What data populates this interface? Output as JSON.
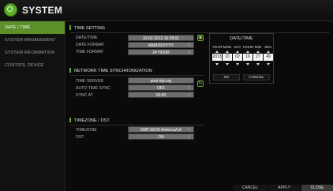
{
  "header": {
    "title": "SYSTEM"
  },
  "sidebar": {
    "items": [
      {
        "label": "DATE / TIME",
        "active": true
      },
      {
        "label": "SYSTEM MANAGEMENT",
        "active": false
      },
      {
        "label": "SYSTEM INFORMATION",
        "active": false
      },
      {
        "label": "CONTROL DEVICE",
        "active": false
      }
    ]
  },
  "time_setting": {
    "title": "TIME SETTING",
    "rows": [
      {
        "label": "DATE/TIME",
        "value": "10-02-2013 16:28:01"
      },
      {
        "label": "DATE FORMAT",
        "value": "MM/DD/YYYY"
      },
      {
        "label": "TIME FORMAT",
        "value": "24 HOUR"
      }
    ]
  },
  "ntp": {
    "title": "NETWORK TIME SYNCHRONIZATION",
    "rows": [
      {
        "label": "TIME SERVER",
        "value": "pool.ntp.org"
      },
      {
        "label": "AUTO TIME SYNC",
        "value": "OFF"
      },
      {
        "label": "SYNC AT",
        "value": "00:00"
      }
    ]
  },
  "timezone": {
    "title": "TIMEZONE / DST",
    "rows": [
      {
        "label": "TIMEZONE",
        "value": "GMT-08:00 America/LA"
      },
      {
        "label": "DST",
        "value": "ON"
      }
    ]
  },
  "dialog": {
    "title": "DATE/TIME",
    "columns": [
      "YEAR",
      "MON",
      "DAY",
      "HOUR",
      "MIN",
      "SEC"
    ],
    "values": [
      "2013",
      "10",
      "02",
      "16",
      "27",
      "49"
    ],
    "ok_label": "OK",
    "cancel_label": "CANCEL"
  },
  "footer": {
    "cancel_label": "CANCEL",
    "apply_label": "APPLY",
    "close_label": "CLOSE"
  },
  "colors": {
    "accent": "#5fae2d",
    "active_tab": "#5d8f2a",
    "field_bg": "#6e6e6e",
    "background": "#0a0a0a"
  },
  "icons": {
    "logo": "gear-logo-icon",
    "calendar": "calendar-icon",
    "sync": "sync-icon"
  }
}
